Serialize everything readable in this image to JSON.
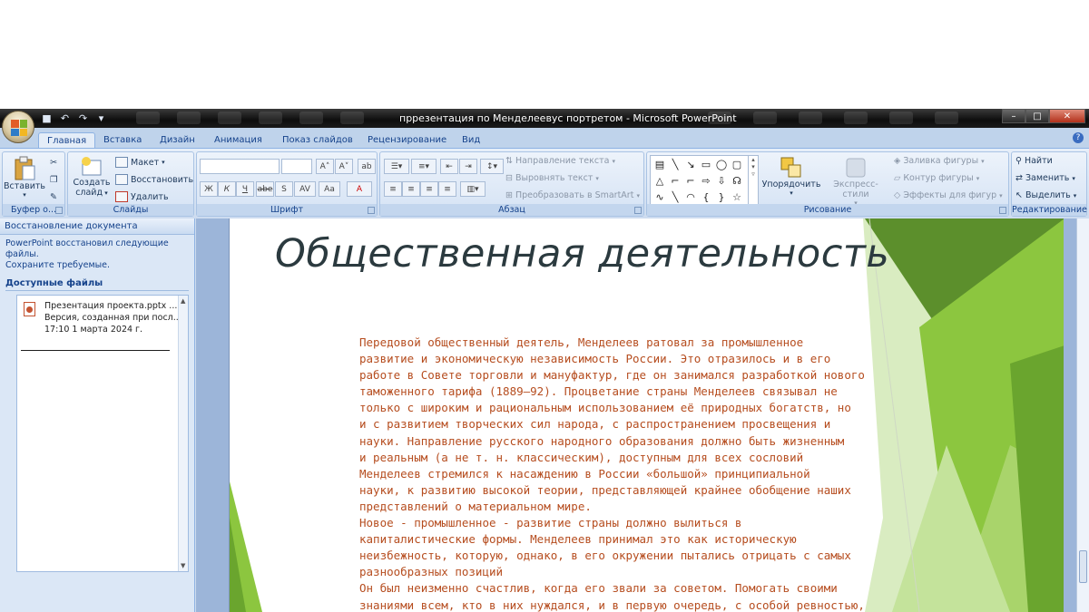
{
  "window": {
    "title": "пррезентация по Менделеевус портретом - Microsoft PowerPoint"
  },
  "tabs": [
    {
      "label": "Главная"
    },
    {
      "label": "Вставка"
    },
    {
      "label": "Дизайн"
    },
    {
      "label": "Анимация"
    },
    {
      "label": "Показ слайдов"
    },
    {
      "label": "Рецензирование"
    },
    {
      "label": "Вид"
    }
  ],
  "ribbon": {
    "clipboard": {
      "paste_label": "Вставить",
      "group_label": "Буфер о..."
    },
    "slides": {
      "create_label": "Создать",
      "create_label2": "слайд",
      "layout_label": "Макет",
      "reset_label": "Восстановить",
      "delete_label": "Удалить",
      "group_label": "Слайды"
    },
    "font": {
      "group_label": "Шрифт",
      "bold": "Ж",
      "italic": "К",
      "underline": "Ч",
      "strike": "abe",
      "shadow": "S",
      "spacing": "AV",
      "case": "Aa",
      "color": "A"
    },
    "paragraph": {
      "direction_label": "Направление текста",
      "align_label": "Выровнять текст",
      "smartart_label": "Преобразовать в SmartArt",
      "group_label": "Абзац"
    },
    "drawing": {
      "arrange_label": "Упорядочить",
      "styles_label": "Экспресс-стили",
      "fill_label": "Заливка фигуры",
      "outline_label": "Контур фигуры",
      "effects_label": "Эффекты для фигур",
      "group_label": "Рисование"
    },
    "editing": {
      "find_label": "Найти",
      "replace_label": "Заменить",
      "select_label": "Выделить",
      "group_label": "Редактирование"
    }
  },
  "recovery_pane": {
    "title": "Восстановление документа",
    "message_line1": "PowerPoint восстановил следующие файлы.",
    "message_line2": "Сохраните требуемые.",
    "available_label": "Доступные файлы",
    "file": {
      "name": "Презентация проекта.pptx ...",
      "version": "Версия, созданная при посл...",
      "date": "17:10 1 марта 2024 г."
    }
  },
  "slide": {
    "title": "Общественная деятельность",
    "body_lines": [
      "Передовой общественный деятель, Менделеев ратовал за промышленное",
      "развитие и экономическую независимость России.  Это отразилось и в его",
      "работе в Совете торговли и мануфактур, где он занимался разработкой нового",
      "таможенного тарифа (1889—92). Процветание страны Менделеев связывал не",
      "только с широким и рациональным использованием её природных богатств,  но",
      "и с развитием творческих сил народа, с распространением просвещения и",
      "науки. Направление русского  народного образования должно быть жизненным",
      "и реальным (а не т. н. классическим), доступным для всех сословий",
      "Менделеев стремился к насаждению в России «большой» принципиальной",
      "науки, к развитию высокой теории, представляющей крайнее обобщение  наших",
      "представлений о материальном мире.",
      "Новое - промышленное - развитие страны должно вылиться в",
      "капиталистические формы. Менделеев принимал это как историческую",
      "неизбежность, которую, однако, в его окружении пытались отрицать с самых",
      "разнообразных позиций",
      "Он был неизменно счастлив, когда его  звали за советом. Помогать своими",
      "знаниями всем, кто в них нуждался, и в первую очередь, с особой  ревностью,"
    ]
  },
  "colors": {
    "slide_body_text": "#b64d1f",
    "slide_title": "#2b3a3f",
    "accent_green": "#8cc63f",
    "ribbon_text": "#15428b"
  }
}
